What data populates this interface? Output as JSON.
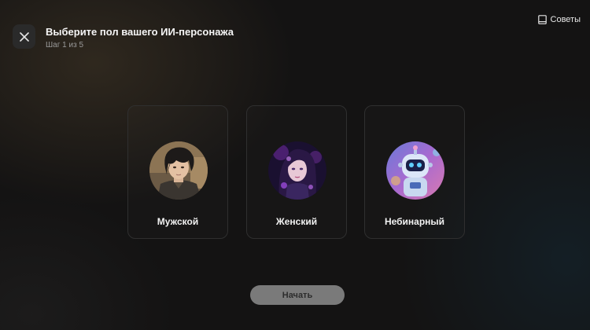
{
  "header": {
    "title": "Выберите пол вашего ИИ-персонажа",
    "step": "Шаг 1 из 5",
    "close_icon": "close-icon",
    "tips_icon": "book-icon",
    "tips_label": "Советы"
  },
  "options": [
    {
      "label": "Мужской"
    },
    {
      "label": "Женский"
    },
    {
      "label": "Небинарный"
    }
  ],
  "start_label": "Начать",
  "colors": {
    "background": "#141313",
    "card_border": "#2f2f2f",
    "start_button": "#7a7a7a"
  }
}
